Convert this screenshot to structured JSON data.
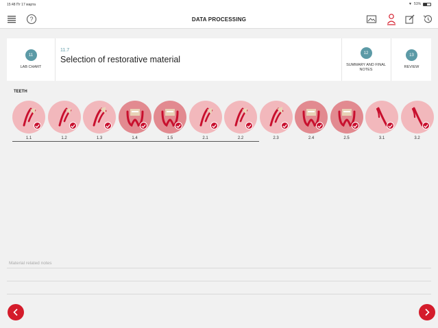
{
  "status_bar": {
    "time": "15:48  Пт 17 марта",
    "battery": "51%"
  },
  "nav": {
    "title": "DATA PROCESSING"
  },
  "steps": {
    "prev": {
      "number": "11",
      "label": "LAB CHART"
    },
    "current": {
      "number": "11.7",
      "title": "Selection of restorative material"
    },
    "next": [
      {
        "number": "12",
        "label": "SUMMARY AND FINAL NOTES"
      },
      {
        "number": "13",
        "label": "REVIEW"
      }
    ]
  },
  "teeth_section": {
    "label": "TEETH"
  },
  "teeth": [
    {
      "number": "1.1",
      "kind": "incisor",
      "tone": "light"
    },
    {
      "number": "1.2",
      "kind": "incisor",
      "tone": "light"
    },
    {
      "number": "1.3",
      "kind": "canine",
      "tone": "light"
    },
    {
      "number": "1.4",
      "kind": "premolar",
      "tone": "dark"
    },
    {
      "number": "1.5",
      "kind": "premolar",
      "tone": "dark"
    },
    {
      "number": "2.1",
      "kind": "incisor",
      "tone": "light"
    },
    {
      "number": "2.2",
      "kind": "incisor",
      "tone": "light"
    },
    {
      "number": "2.3",
      "kind": "canine",
      "tone": "light"
    },
    {
      "number": "2.4",
      "kind": "premolar",
      "tone": "dark"
    },
    {
      "number": "2.5",
      "kind": "premolar",
      "tone": "dark"
    },
    {
      "number": "3.1",
      "kind": "lower-incisor",
      "tone": "light"
    },
    {
      "number": "3.2",
      "kind": "lower-incisor",
      "tone": "light"
    }
  ],
  "notes": {
    "placeholder": "Material related notes"
  },
  "colors": {
    "accent_red": "#d41c2b",
    "step_teal": "#5c9aa6",
    "disc_light": "#f2b8bc",
    "disc_dark": "#e28a90"
  },
  "icons": [
    "menu-icon",
    "help-icon",
    "image-icon",
    "person-icon",
    "edit-icon",
    "history-icon",
    "check-icon",
    "chevron-left-icon",
    "chevron-right-icon"
  ]
}
